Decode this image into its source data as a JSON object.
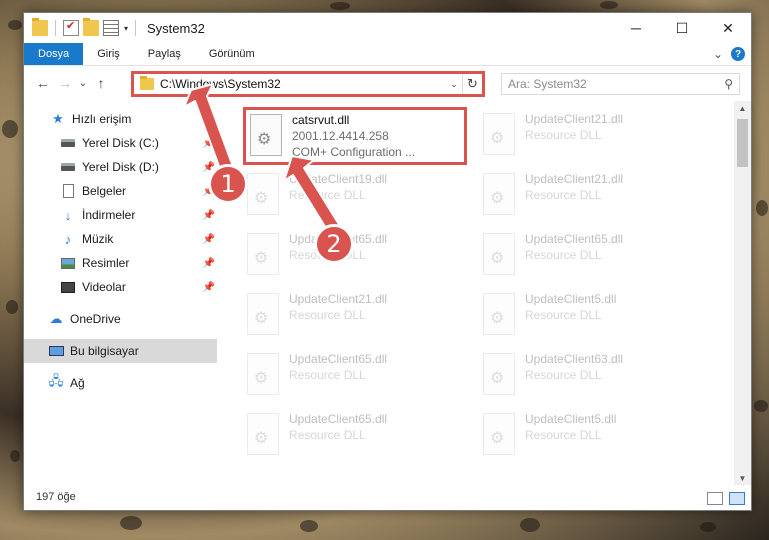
{
  "titlebar": {
    "title": "System32",
    "minimize": "─",
    "maximize": "☐",
    "close": "✕"
  },
  "tabs": [
    {
      "label": "Dosya",
      "active": true
    },
    {
      "label": "Giriş"
    },
    {
      "label": "Paylaş"
    },
    {
      "label": "Görünüm"
    }
  ],
  "ribbon": {
    "expand_glyph": "⌄",
    "help": "?"
  },
  "nav": {
    "back": "←",
    "forward": "→",
    "recent": "⌄",
    "up": "↑"
  },
  "address": {
    "path": "C:\\Windows\\System32",
    "dropdown": "⌄",
    "refresh": "↻"
  },
  "search": {
    "placeholder": "Ara: System32",
    "icon": "search-icon"
  },
  "sidebar": {
    "items": [
      {
        "label": "Hızlı erişim",
        "icon": "star-icon"
      },
      {
        "label": "Yerel Disk (C:)",
        "icon": "drive-icon",
        "pinned": true
      },
      {
        "label": "Yerel Disk (D:)",
        "icon": "drive-icon",
        "pinned": true
      },
      {
        "label": "Belgeler",
        "icon": "document-icon",
        "pinned": true
      },
      {
        "label": "İndirmeler",
        "icon": "download-icon",
        "pinned": true
      },
      {
        "label": "Müzik",
        "icon": "music-icon",
        "pinned": true
      },
      {
        "label": "Resimler",
        "icon": "pictures-icon",
        "pinned": true
      },
      {
        "label": "Videolar",
        "icon": "videos-icon",
        "pinned": true
      },
      {
        "label": "OneDrive",
        "icon": "cloud-icon"
      },
      {
        "label": "Bu bilgisayar",
        "icon": "computer-icon",
        "selected": true
      },
      {
        "label": "Ağ",
        "icon": "network-icon"
      }
    ]
  },
  "files": [
    {
      "name": "catsrvut.dll",
      "line1": "2001.12.4414.258",
      "line2": "COM+ Configuration ...",
      "highlight": true
    },
    {
      "name": "UpdateClient21.dll",
      "line1": "Resource DLL"
    },
    {
      "name": "UpdateClient19.dll",
      "line1": "Resource DLL"
    },
    {
      "name": "UpdateClient21.dll",
      "line1": "Resource DLL"
    },
    {
      "name": "UpdateClient65.dll",
      "line1": "Resource DLL"
    },
    {
      "name": "UpdateClient65.dll",
      "line1": "Resource DLL"
    },
    {
      "name": "UpdateClient21.dll",
      "line1": "Resource DLL"
    },
    {
      "name": "UpdateClient5.dll",
      "line1": "Resource DLL"
    },
    {
      "name": "UpdateClient65.dll",
      "line1": "Resource DLL"
    },
    {
      "name": "UpdateClient63.dll",
      "line1": "Resource DLL"
    },
    {
      "name": "UpdateClient65.dll",
      "line1": "Resource DLL"
    },
    {
      "name": "UpdateClient5.dll",
      "line1": "Resource DLL"
    }
  ],
  "status": {
    "count": "197 öğe"
  },
  "annotations": {
    "badge1": "1",
    "badge2": "2",
    "color": "#d9534f"
  }
}
